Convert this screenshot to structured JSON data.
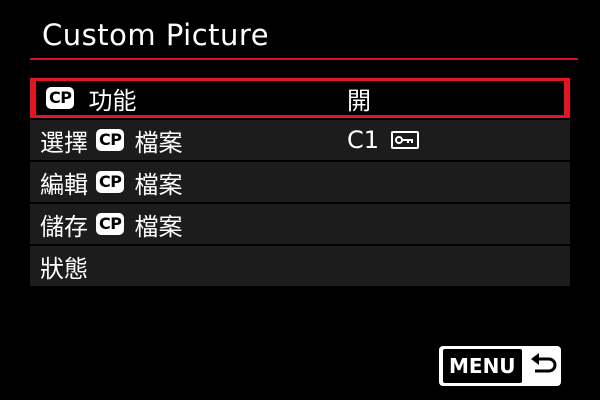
{
  "header": {
    "title": "Custom Picture"
  },
  "menu": {
    "items": [
      {
        "prefix": "",
        "badge": "CP",
        "suffix": "功能",
        "value": "開",
        "selected": true
      },
      {
        "prefix": "選擇",
        "badge": "CP",
        "suffix": "檔案",
        "value": "C1",
        "value_icon": "key-icon"
      },
      {
        "prefix": "編輯",
        "badge": "CP",
        "suffix": "檔案",
        "value": ""
      },
      {
        "prefix": "儲存",
        "badge": "CP",
        "suffix": "檔案",
        "value": ""
      },
      {
        "prefix": "狀態",
        "badge": "",
        "suffix": "",
        "value": ""
      }
    ]
  },
  "footer": {
    "menu_label": "MENU",
    "return_icon": "return-arrow-icon"
  },
  "colors": {
    "accent": "#e2161e",
    "rule": "#d8102a",
    "row_bg": "#1c1c1c"
  }
}
